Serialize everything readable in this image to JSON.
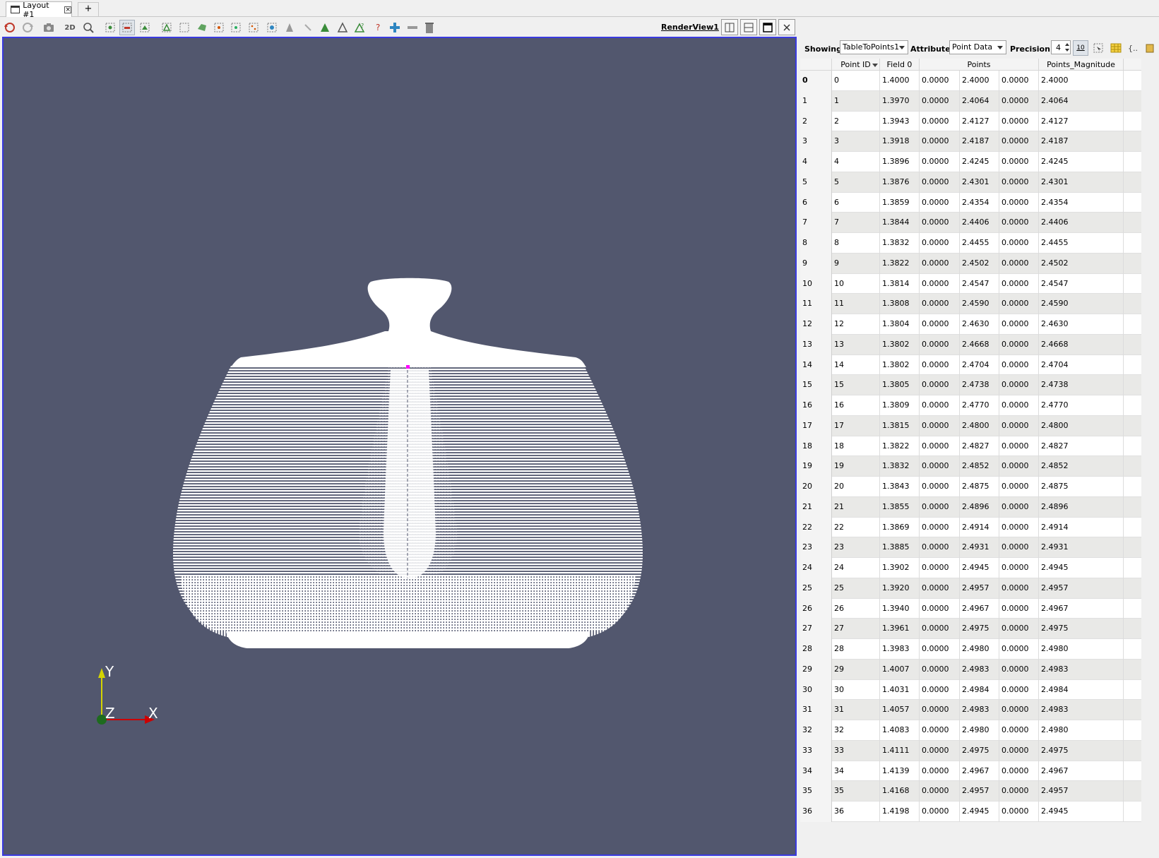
{
  "tabs": {
    "layout_tab": "Layout #1",
    "add_tab": "+"
  },
  "toolbar": {
    "two_d_label": "2D",
    "renderview_name": "RenderView1",
    "icons": [
      "reset-camera-icon",
      "redo-camera-icon",
      "screenshot-icon",
      "zoom-to-box-icon",
      "zoom-to-data-icon",
      "select-cells-icon",
      "select-points-icon",
      "select-frustum-icon",
      "select-block-icon",
      "interactive-select-icon",
      "select-polygon-icon",
      "grow-selection-icon",
      "shrink-selection-icon",
      "find-data-icon",
      "add-node-icon",
      "remove-node-icon",
      "clear-icon"
    ]
  },
  "render_view": {
    "background_color": "#52576e",
    "geometry_color": "#ffffff",
    "selection_color": "#ff00ff",
    "axes": {
      "y": "Y",
      "z": "Z",
      "x": "X"
    }
  },
  "spreadsheet": {
    "showing_label": "Showing",
    "showing_value": "TableToPoints1",
    "attribute_label": "Attribute:",
    "attribute_value": "Point Data",
    "precision_label": "Precision:",
    "precision_value": "4",
    "toggle_label": "10",
    "columns": [
      "Point ID",
      "Field 0",
      "Points",
      "Points_Magnitude"
    ],
    "rows": [
      [
        "0",
        "0",
        "1.4000",
        "0.0000",
        "2.4000",
        "0.0000",
        "2.4000"
      ],
      [
        "1",
        "1",
        "1.3970",
        "0.0000",
        "2.4064",
        "0.0000",
        "2.4064"
      ],
      [
        "2",
        "2",
        "1.3943",
        "0.0000",
        "2.4127",
        "0.0000",
        "2.4127"
      ],
      [
        "3",
        "3",
        "1.3918",
        "0.0000",
        "2.4187",
        "0.0000",
        "2.4187"
      ],
      [
        "4",
        "4",
        "1.3896",
        "0.0000",
        "2.4245",
        "0.0000",
        "2.4245"
      ],
      [
        "5",
        "5",
        "1.3876",
        "0.0000",
        "2.4301",
        "0.0000",
        "2.4301"
      ],
      [
        "6",
        "6",
        "1.3859",
        "0.0000",
        "2.4354",
        "0.0000",
        "2.4354"
      ],
      [
        "7",
        "7",
        "1.3844",
        "0.0000",
        "2.4406",
        "0.0000",
        "2.4406"
      ],
      [
        "8",
        "8",
        "1.3832",
        "0.0000",
        "2.4455",
        "0.0000",
        "2.4455"
      ],
      [
        "9",
        "9",
        "1.3822",
        "0.0000",
        "2.4502",
        "0.0000",
        "2.4502"
      ],
      [
        "10",
        "10",
        "1.3814",
        "0.0000",
        "2.4547",
        "0.0000",
        "2.4547"
      ],
      [
        "11",
        "11",
        "1.3808",
        "0.0000",
        "2.4590",
        "0.0000",
        "2.4590"
      ],
      [
        "12",
        "12",
        "1.3804",
        "0.0000",
        "2.4630",
        "0.0000",
        "2.4630"
      ],
      [
        "13",
        "13",
        "1.3802",
        "0.0000",
        "2.4668",
        "0.0000",
        "2.4668"
      ],
      [
        "14",
        "14",
        "1.3802",
        "0.0000",
        "2.4704",
        "0.0000",
        "2.4704"
      ],
      [
        "15",
        "15",
        "1.3805",
        "0.0000",
        "2.4738",
        "0.0000",
        "2.4738"
      ],
      [
        "16",
        "16",
        "1.3809",
        "0.0000",
        "2.4770",
        "0.0000",
        "2.4770"
      ],
      [
        "17",
        "17",
        "1.3815",
        "0.0000",
        "2.4800",
        "0.0000",
        "2.4800"
      ],
      [
        "18",
        "18",
        "1.3822",
        "0.0000",
        "2.4827",
        "0.0000",
        "2.4827"
      ],
      [
        "19",
        "19",
        "1.3832",
        "0.0000",
        "2.4852",
        "0.0000",
        "2.4852"
      ],
      [
        "20",
        "20",
        "1.3843",
        "0.0000",
        "2.4875",
        "0.0000",
        "2.4875"
      ],
      [
        "21",
        "21",
        "1.3855",
        "0.0000",
        "2.4896",
        "0.0000",
        "2.4896"
      ],
      [
        "22",
        "22",
        "1.3869",
        "0.0000",
        "2.4914",
        "0.0000",
        "2.4914"
      ],
      [
        "23",
        "23",
        "1.3885",
        "0.0000",
        "2.4931",
        "0.0000",
        "2.4931"
      ],
      [
        "24",
        "24",
        "1.3902",
        "0.0000",
        "2.4945",
        "0.0000",
        "2.4945"
      ],
      [
        "25",
        "25",
        "1.3920",
        "0.0000",
        "2.4957",
        "0.0000",
        "2.4957"
      ],
      [
        "26",
        "26",
        "1.3940",
        "0.0000",
        "2.4967",
        "0.0000",
        "2.4967"
      ],
      [
        "27",
        "27",
        "1.3961",
        "0.0000",
        "2.4975",
        "0.0000",
        "2.4975"
      ],
      [
        "28",
        "28",
        "1.3983",
        "0.0000",
        "2.4980",
        "0.0000",
        "2.4980"
      ],
      [
        "29",
        "29",
        "1.4007",
        "0.0000",
        "2.4983",
        "0.0000",
        "2.4983"
      ],
      [
        "30",
        "30",
        "1.4031",
        "0.0000",
        "2.4984",
        "0.0000",
        "2.4984"
      ],
      [
        "31",
        "31",
        "1.4057",
        "0.0000",
        "2.4983",
        "0.0000",
        "2.4983"
      ],
      [
        "32",
        "32",
        "1.4083",
        "0.0000",
        "2.4980",
        "0.0000",
        "2.4980"
      ],
      [
        "33",
        "33",
        "1.4111",
        "0.0000",
        "2.4975",
        "0.0000",
        "2.4975"
      ],
      [
        "34",
        "34",
        "1.4139",
        "0.0000",
        "2.4967",
        "0.0000",
        "2.4967"
      ],
      [
        "35",
        "35",
        "1.4168",
        "0.0000",
        "2.4957",
        "0.0000",
        "2.4957"
      ],
      [
        "36",
        "36",
        "1.4198",
        "0.0000",
        "2.4945",
        "0.0000",
        "2.4945"
      ]
    ]
  }
}
